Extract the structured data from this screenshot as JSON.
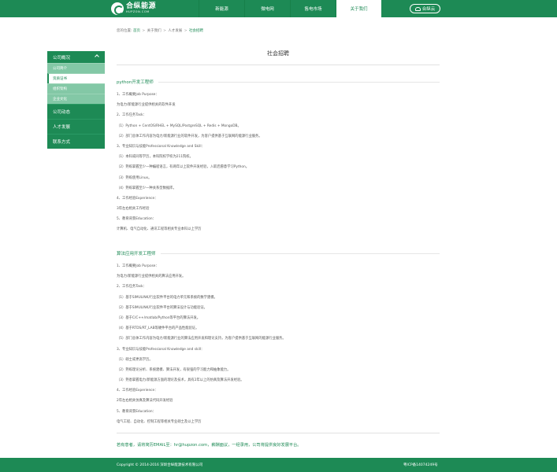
{
  "header": {
    "logo_cn": "合纵能源",
    "logo_en": "HUPZON.COM",
    "nav": [
      {
        "label": "新能源",
        "active": false
      },
      {
        "label": "微电网",
        "active": false
      },
      {
        "label": "售电市场",
        "active": false
      },
      {
        "label": "关于我们",
        "active": true
      }
    ],
    "cloud_label": "合纵云"
  },
  "breadcrumb": {
    "prefix": "您的位置:",
    "items": [
      "首页",
      "关于我们",
      "人才发展",
      "社会招聘"
    ],
    "separator": ">"
  },
  "sidebar": {
    "section_title": "公司概况",
    "sub_items": [
      {
        "label": "公司简介",
        "active": false
      },
      {
        "label": "资质证书",
        "active": true
      },
      {
        "label": "组织架构",
        "active": false
      },
      {
        "label": "企业文化",
        "active": false
      }
    ],
    "main_items": [
      "公司动态",
      "人才发展",
      "联系方式"
    ]
  },
  "page_title": "社会招聘",
  "jobs": [
    {
      "title": "python开发工程师",
      "lines": [
        "1、工作概要Job Purpose：",
        "为电力/新能源行业提供相关的软件开发",
        "2、工作任务Task：",
        "（1）Python + CentOS/RHEL + MySQL/PostgreSQL + Redis + MongoDB。",
        "（2）部门总体工作内容为电力/新能源行业的软件开发，为客户提供基于互联网的能源行业服务。",
        "3、专业知识与技能Professional Knowledge and Skill：",
        "（1）本科或同等学历，本科院校学校为211院校。",
        "（2）熟练掌握至少一种编程语言，有两年以上软件开发经验，入职后愿意学习Python。",
        "（3）熟练使用Linux。",
        "（4）熟练掌握至少一种关系型数据库。",
        "4、工作经验Experience：",
        "3年左右相关工作经验",
        "5、教育背景Education：",
        "计算机、电气自动化、通讯工程等相关专业本科以上学历"
      ]
    },
    {
      "title": "算法应用开发工程师",
      "lines": [
        "1、工作概要Job Purpose：",
        "为电力/新能源行业提供相关的算法应用开发。",
        "2、工作任务Task：",
        "（1）基于SIMULINK/行业软件平台的电力单元和系统的数学建模。",
        "（2）基于SIMULINK/行业软件平台的算法设计与功能验证。",
        "（3）基于C/C++/matlab/Python等平台的算法开发。",
        "（4）基于RTDS/RT_LAB等硬件平台的产品性能验证。",
        "（5）部门总体工作内容为电力/新能源行业的算法应用开发和理论支持，为客户提供基于互联网的能源行业服务。",
        "3、专业知识与技能Professional Knowledge and skill：",
        "（1）硕士或更高学历。",
        "（2）熟练理论分析、系统建模、算法开发，有很强的学习能力和抽象能力。",
        "（3）熟悉掌握电力/新能源方面的理论及技术，具有2年以上的仿真及算法开发经验。",
        "4、工作经验Experience：",
        "2年左右相关仿真及算法代码开发经验",
        "5、教育背景Education：",
        "电气工程、自动化、控制工程等相关专业硕士及以上学历"
      ]
    }
  ],
  "contact_note": "若有意者，请将简历EMAIL至：hr@hupzon.com，薪酬面议，一经录用，公司将提供良好发展平台。",
  "footer": {
    "copyright": "Copyright © 2014-2016 深圳合纵能源技术有限公司",
    "icp": "粤ICP备14074249号"
  }
}
